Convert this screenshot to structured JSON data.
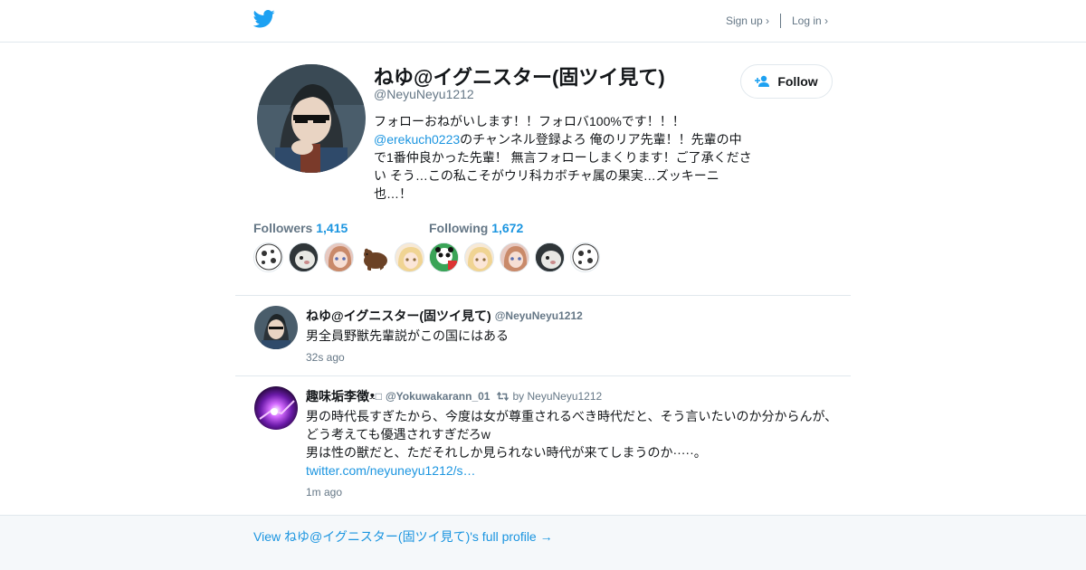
{
  "header": {
    "signup_label": "Sign up ›",
    "login_label": "Log in ›",
    "logo_icon": "twitter-bird-icon",
    "brand_color": "#1da1f2"
  },
  "profile": {
    "name": "ねゆ@イグニスター(固ツイ見て)",
    "handle": "@NeyuNeyu1212",
    "follow_label": "Follow",
    "bio": {
      "line1": "フォローおねがいします！！フォロバ100%です！！！",
      "mention": "@erekuch0223",
      "line2_rest": "のチャンネル登録よろ 俺のリア先輩！！先輩の中",
      "line3": "で1番仲良かった先輩！ 無言フォローしまくります！ご了承くださ",
      "line4": "い そう…この私こそがウリ科カボチャ属の果実…ズッキーニ",
      "line5": "也…！"
    }
  },
  "stats": {
    "followers_label": "Followers",
    "followers_count": "1,415",
    "following_label": "Following",
    "following_count": "1,672"
  },
  "tweets": [
    {
      "name": "ねゆ@イグニスター(固ツイ見て)",
      "handle": "@NeyuNeyu1212",
      "text": "男全員野獣先輩説がこの国にはある",
      "time": "32s ago"
    },
    {
      "name": "趣味垢李徴",
      "name_emoji": "ᴥ",
      "name_box": "□",
      "handle": "@Yokuwakarann_01",
      "retweet_by": "by NeyuNeyu1212",
      "text_line1": "男の時代長すぎたから、今度は女が尊重されるべき時代だと、そう言いたいのか分からんが、",
      "text_line2": "どう考えても優遇されすぎだろw",
      "text_line3": "男は性の獣だと、ただそれしか見られない時代が来てしまうのか·····。",
      "link": "twitter.com/neyuneyu1212/s…",
      "time": "1m ago"
    }
  ],
  "footer": {
    "full_profile_link": "View ねゆ@イグニスター(固ツイ見て)'s full profile →"
  }
}
